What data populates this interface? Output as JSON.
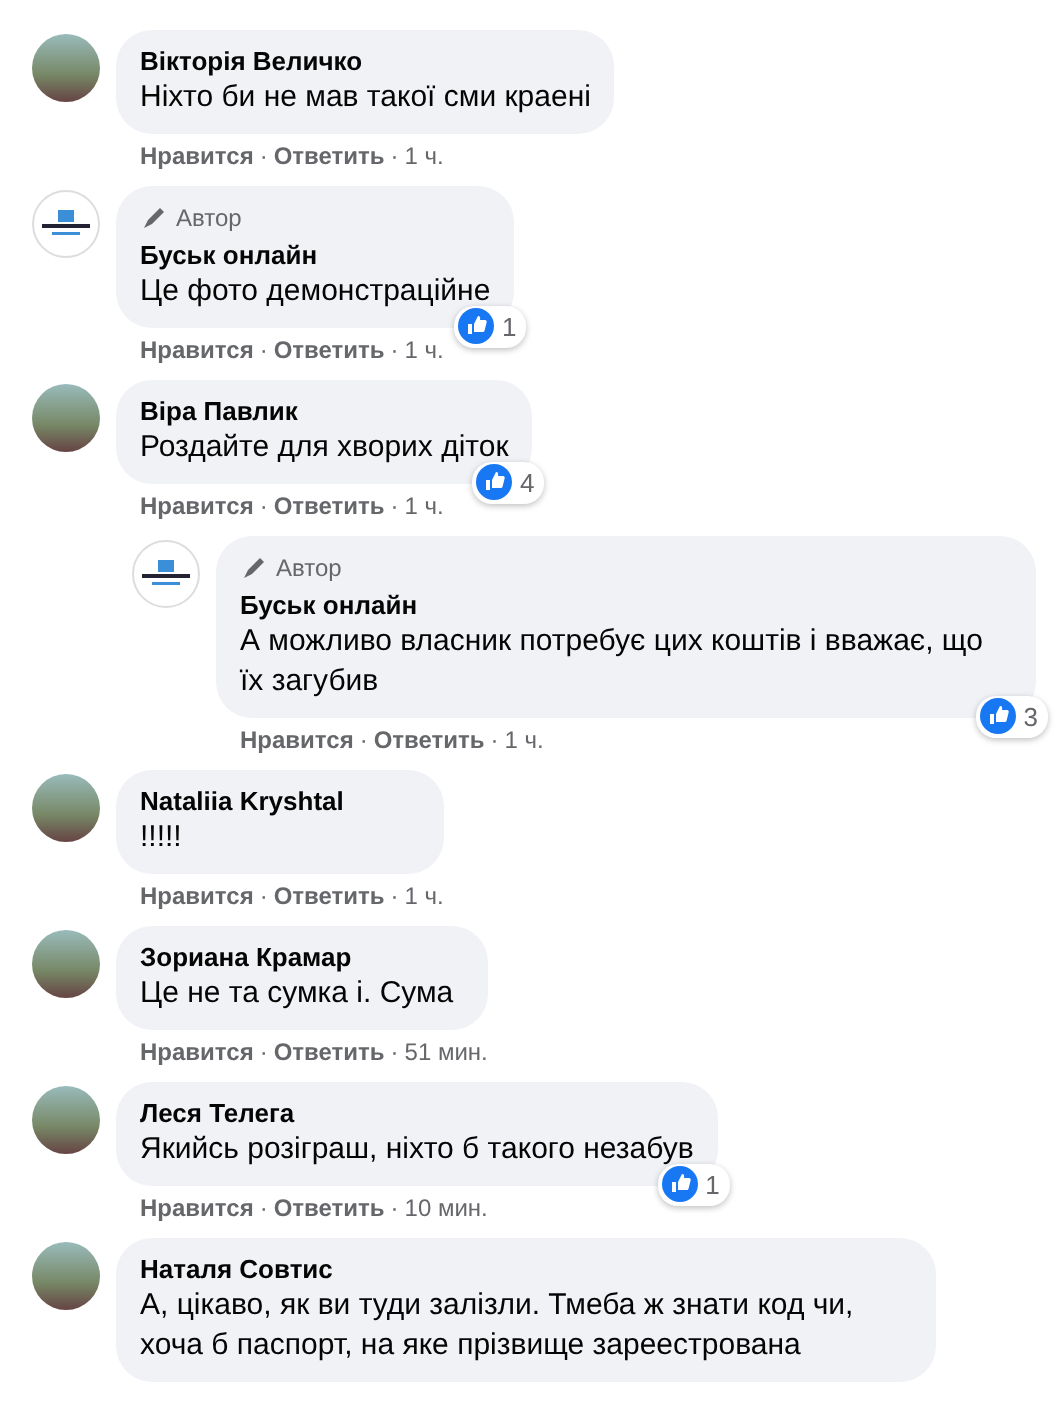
{
  "comments": [
    {
      "kind": "photo",
      "author": "Вікторія Величко",
      "text": "Ніхто би не мав такої сми краені",
      "footer": [
        {
          "kind": "link",
          "text": "Нравится"
        },
        {
          "kind": "dot",
          "text": "·"
        },
        {
          "kind": "link",
          "text": "Ответить"
        },
        {
          "kind": "dot",
          "text": "·"
        },
        {
          "kind": "time",
          "text": "1 ч."
        }
      ]
    },
    {
      "kind": "logo",
      "author": "Буськ онлайн",
      "badge": "Автор",
      "text": "Це фото демонстраційне",
      "reactions": "1",
      "footer": [
        {
          "kind": "link",
          "text": "Нравится"
        },
        {
          "kind": "dot",
          "text": "·"
        },
        {
          "kind": "link",
          "text": "Ответить"
        },
        {
          "kind": "dot",
          "text": "·"
        },
        {
          "kind": "time",
          "text": "1 ч."
        }
      ]
    },
    {
      "kind": "photo",
      "author": "Віра Павлик",
      "text": "Роздайте для хворих діток",
      "reactions": "4",
      "footer": [
        {
          "kind": "link",
          "text": "Нравится"
        },
        {
          "kind": "dot",
          "text": "·"
        },
        {
          "kind": "link",
          "text": "Ответить"
        },
        {
          "kind": "dot",
          "text": "·"
        },
        {
          "kind": "time",
          "text": "1 ч."
        }
      ],
      "children": [
        {
          "kind": "logo",
          "author": "Буськ онлайн",
          "badge": "Автор",
          "text": "А можливо власник потребує цих коштів і вважає, що їх загубив",
          "reactions": "3",
          "footer": [
            {
              "kind": "link",
              "text": "Нравится"
            },
            {
              "kind": "dot",
              "text": "·"
            },
            {
              "kind": "link",
              "text": "Ответить"
            },
            {
              "kind": "dot",
              "text": "·"
            },
            {
              "kind": "time",
              "text": "1 ч."
            }
          ]
        }
      ]
    },
    {
      "kind": "photo",
      "author": "Nataliia Kryshtal",
      "text": "!!!!!",
      "footer": [
        {
          "kind": "link",
          "text": "Нравится"
        },
        {
          "kind": "dot",
          "text": "·"
        },
        {
          "kind": "link",
          "text": "Ответить"
        },
        {
          "kind": "dot",
          "text": "·"
        },
        {
          "kind": "time",
          "text": "1 ч."
        }
      ]
    },
    {
      "kind": "photo",
      "author": "Зориана Крамар",
      "text": "Це не та сумка і. Сума",
      "footer": [
        {
          "kind": "link",
          "text": "Нравится"
        },
        {
          "kind": "dot",
          "text": "·"
        },
        {
          "kind": "link",
          "text": "Ответить"
        },
        {
          "kind": "dot",
          "text": "·"
        },
        {
          "kind": "time",
          "text": "51 мин."
        }
      ]
    },
    {
      "kind": "photo",
      "author": "Леся Телега",
      "text": "Якийсь розіграш, ніхто б такого незабув",
      "reactions": "1",
      "footer": [
        {
          "kind": "link",
          "text": "Нравится"
        },
        {
          "kind": "dot",
          "text": "·"
        },
        {
          "kind": "link",
          "text": "Ответить"
        },
        {
          "kind": "dot",
          "text": "·"
        },
        {
          "kind": "time",
          "text": "10 мин."
        }
      ]
    },
    {
      "kind": "photo",
      "author": "Наталя Совтис",
      "text": "А, цікаво, як ви туди залізли. Тмеба ж знати код чи, хоча б паспорт, на яке прізвище зареестрована"
    }
  ]
}
